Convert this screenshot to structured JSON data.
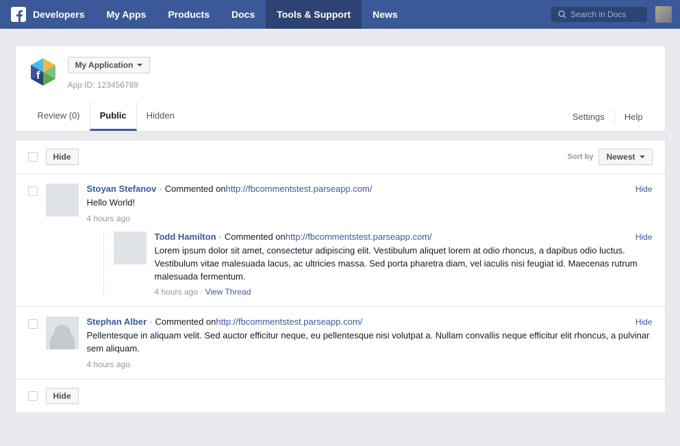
{
  "nav": {
    "brand": "Developers",
    "items": [
      "My Apps",
      "Products",
      "Docs",
      "Tools & Support",
      "News"
    ],
    "active_index": 3,
    "search_placeholder": "Search in Docs"
  },
  "app": {
    "name": "My Application",
    "id_label": "App ID: 123456789"
  },
  "tabs": {
    "items": [
      "Review (0)",
      "Public",
      "Hidden"
    ],
    "active_index": 1,
    "right": [
      "Settings",
      "Help"
    ]
  },
  "toolbar": {
    "hide_label": "Hide",
    "sort_label": "Sort by",
    "sort_value": "Newest"
  },
  "comments": [
    {
      "author": "Stoyan Stefanov",
      "action_text": "Commented on",
      "link": "http://fbcommentstest.parseapp.com/",
      "text": "Hello World!",
      "timestamp": "4 hours ago",
      "hide_label": "Hide",
      "avatar_class": "av1",
      "replies": [
        {
          "author": "Todd Hamilton",
          "action_text": "Commented on",
          "link": "http://fbcommentstest.parseapp.com/",
          "text": "Lorem ipsum dolor sit amet, consectetur adipiscing elit. Vestibulum aliquet lorem at odio rhoncus, a dapibus odio luctus. Vestibulum vitae malesuada lacus, ac ultricies massa. Sed porta pharetra diam, vel iaculis nisi feugiat id. Maecenas rutrum malesuada fermentum.",
          "timestamp": "4 hours ago",
          "view_thread_label": "View Thread",
          "hide_label": "Hide",
          "avatar_class": "av2"
        }
      ]
    },
    {
      "author": "Stephan Alber",
      "action_text": "Commented on",
      "link": "http://fbcommentstest.parseapp.com/",
      "text": "Pellentesque in aliquam velit. Sed auctor efficitur neque, eu pellentesque nisi volutpat a. Nullam convallis neque efficitur elit rhoncus, a pulvinar sem aliquam.",
      "timestamp": "4 hours ago",
      "hide_label": "Hide",
      "avatar_class": "av-default",
      "replies": []
    }
  ]
}
